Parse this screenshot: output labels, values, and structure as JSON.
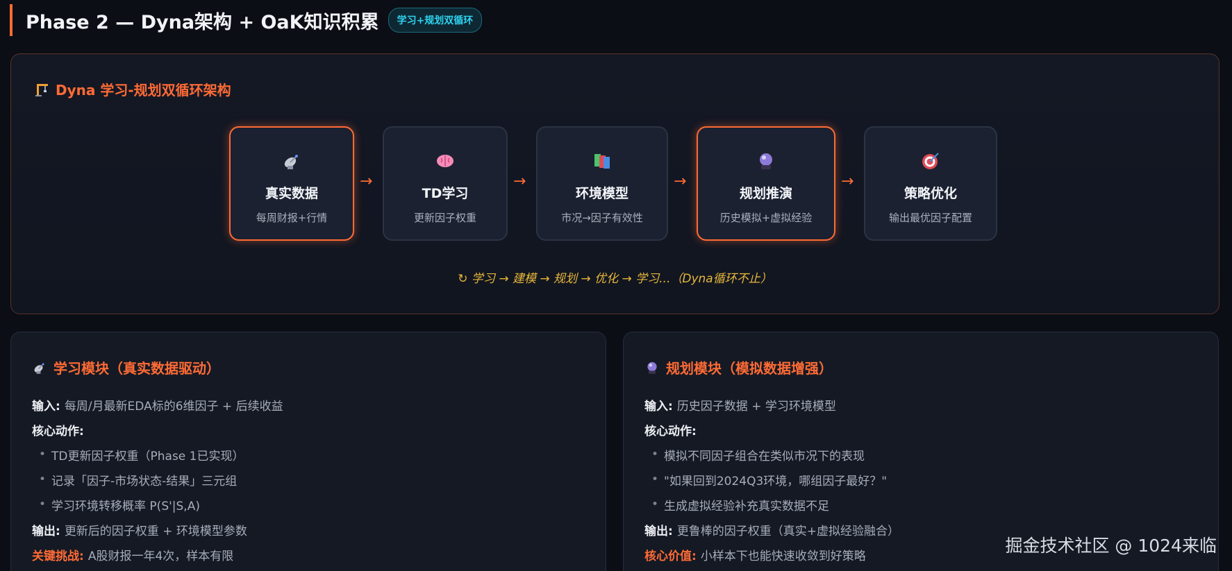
{
  "header": {
    "title": "Phase 2 — Dyna架构 + OaK知识积累",
    "badge": "学习+规划双循环"
  },
  "dyna": {
    "title": "Dyna 学习-规划双循环架构",
    "nodes": [
      {
        "icon": "satellite-dish-icon",
        "title": "真实数据",
        "sub": "每周财报+行情",
        "active": true
      },
      {
        "icon": "brain-icon",
        "title": "TD学习",
        "sub": "更新因子权重",
        "active": false
      },
      {
        "icon": "books-icon",
        "title": "环境模型",
        "sub": "市况→因子有效性",
        "active": false
      },
      {
        "icon": "crystal-ball-icon",
        "title": "规划推演",
        "sub": "历史模拟+虚拟经验",
        "active": true
      },
      {
        "icon": "target-icon",
        "title": "策略优化",
        "sub": "输出最优因子配置",
        "active": false
      }
    ],
    "arrow": "→",
    "cycle_note": "↻ 学习 → 建模 → 规划 → 优化 → 学习...（Dyna循环不止）"
  },
  "learning_module": {
    "title": "学习模块（真实数据驱动）",
    "input_label": "输入:",
    "input_text": "每周/月最新EDA标的6维因子 + 后续收益",
    "core_label": "核心动作:",
    "bullets": [
      "TD更新因子权重（Phase 1已实现）",
      "记录「因子-市场状态-结果」三元组",
      "学习环境转移概率 P(S'|S,A)"
    ],
    "output_label": "输出:",
    "output_text": "更新后的因子权重 + 环境模型参数",
    "extra_label": "关键挑战:",
    "extra_text": "A股财报一年4次，样本有限"
  },
  "planning_module": {
    "title": "规划模块（模拟数据增强）",
    "input_label": "输入:",
    "input_text": "历史因子数据 + 学习环境模型",
    "core_label": "核心动作:",
    "bullets": [
      "模拟不同因子组合在类似市况下的表现",
      "\"如果回到2024Q3环境，哪组因子最好？\"",
      "生成虚拟经验补充真实数据不足"
    ],
    "output_label": "输出:",
    "output_text": "更鲁棒的因子权重（真实+虚拟经验融合）",
    "extra_label": "核心价值:",
    "extra_text": "小样本下也能快速收敛到好策略"
  },
  "watermark": "掘金技术社区 @ 1024来临",
  "colors": {
    "accent": "#ff6b35",
    "badge": "#2fd3f0",
    "note": "#e7b73a",
    "background": "#0b0e15"
  }
}
